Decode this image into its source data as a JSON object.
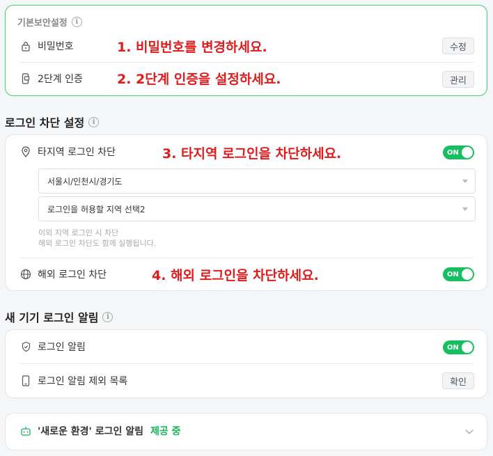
{
  "basic_security": {
    "title": "기본보안설정",
    "password_label": "비밀번호",
    "password_button": "수정",
    "twofactor_label": "2단계 인증",
    "twofactor_button": "관리",
    "annot1": "1. 비밀번호를 변경하세요.",
    "annot2": "2. 2단계 인증을 설정하세요."
  },
  "login_block": {
    "title": "로그인 차단 설정",
    "region_label": "타지역 로그인 차단",
    "region_toggle": "ON",
    "annot3": "3. 타지역 로그인을 차단하세요.",
    "select1_value": "서울시/인천시/경기도",
    "select2_value": "로그인을 허용할 지역 선택2",
    "hint_line1": "이외 지역 로그인 시 차단",
    "hint_line2": "해외 로그인 차단도 함께 실행됩니다.",
    "overseas_label": "해외 로그인 차단",
    "overseas_toggle": "ON",
    "annot4": "4. 해외 로그인을 차단하세요."
  },
  "new_device": {
    "title": "새 기기 로그인 알림",
    "alert_label": "로그인 알림",
    "alert_toggle": "ON",
    "exclude_label": "로그인 알림 제외 목록",
    "exclude_button": "확인"
  },
  "new_env": {
    "label": "'새로운 환경' 로그인 알림",
    "status": "제공 중"
  },
  "colors": {
    "accent_green": "#16c060",
    "annotation_red": "#e01b1b",
    "border_green": "#3ecf6f"
  }
}
